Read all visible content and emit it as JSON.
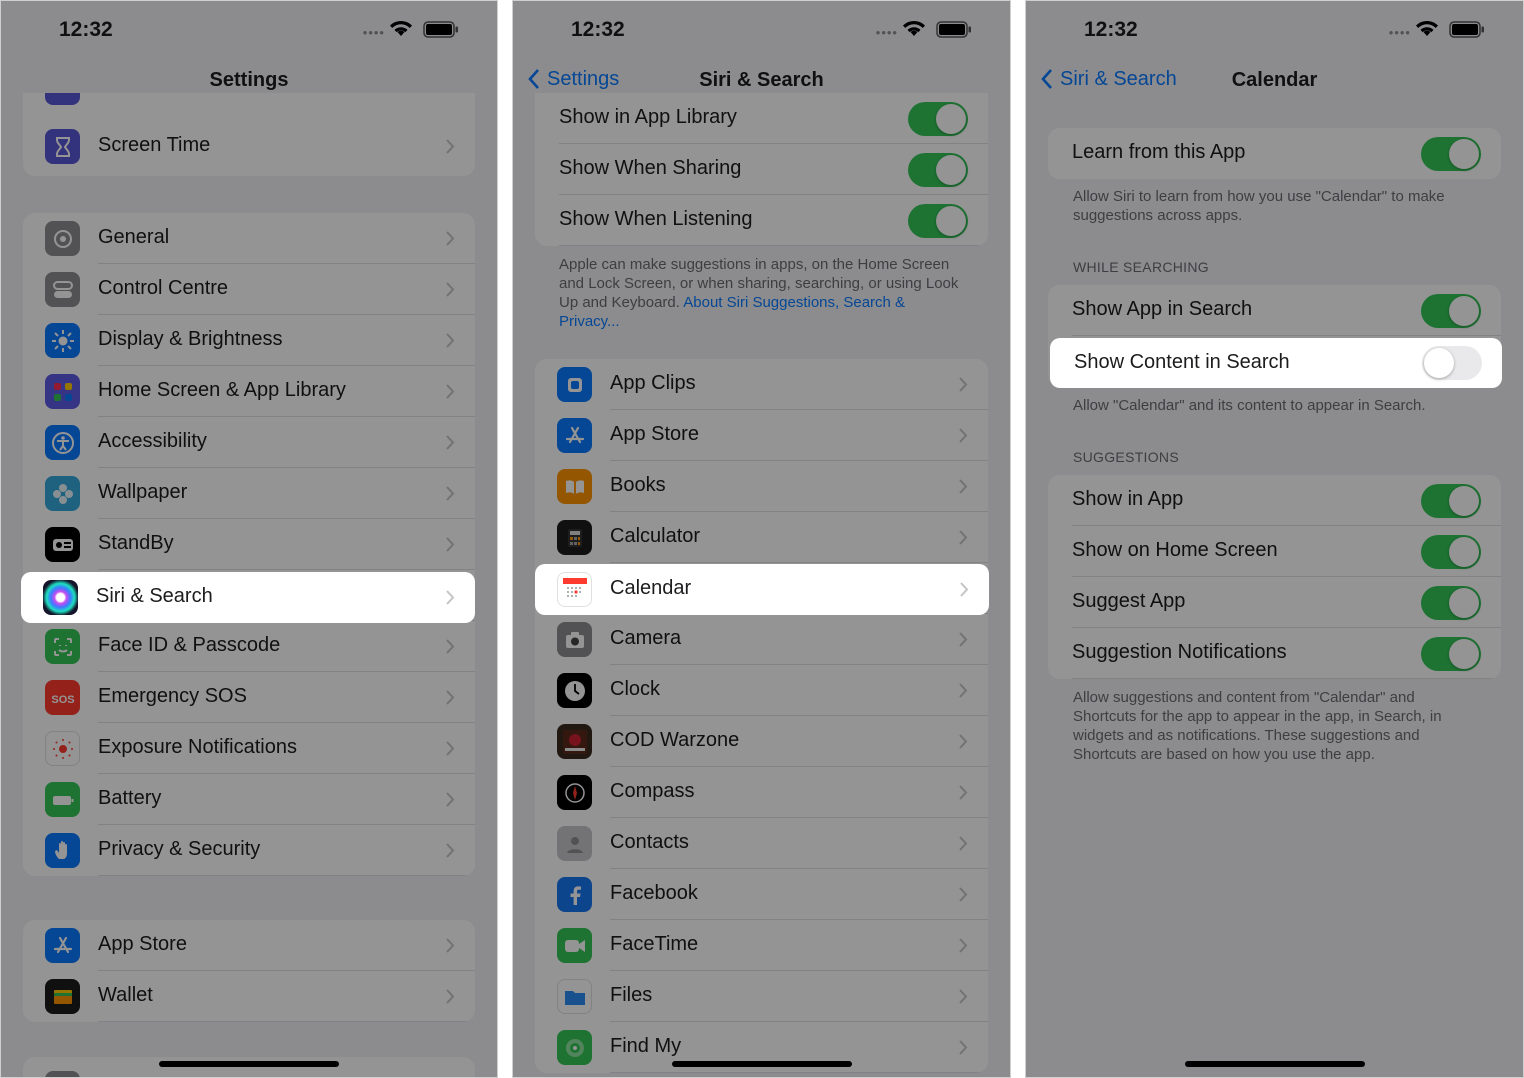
{
  "status": {
    "time": "12:32"
  },
  "screen1": {
    "title": "Settings",
    "group_top": [
      {
        "label": "Screen Time",
        "icon": "hourglass-icon",
        "color": "#5856d6"
      }
    ],
    "group_main": [
      {
        "label": "General",
        "icon": "gear-icon",
        "color": "#8e8e93"
      },
      {
        "label": "Control Centre",
        "icon": "switches-icon",
        "color": "#8e8e93"
      },
      {
        "label": "Display & Brightness",
        "icon": "sun-icon",
        "color": "#0a7aff"
      },
      {
        "label": "Home Screen & App Library",
        "icon": "app-grid-icon",
        "color": "#5e5ce6"
      },
      {
        "label": "Accessibility",
        "icon": "accessibility-icon",
        "color": "#0a7aff"
      },
      {
        "label": "Wallpaper",
        "icon": "flower-icon",
        "color": "#34aadc"
      },
      {
        "label": "StandBy",
        "icon": "standby-icon",
        "color": "#000000"
      },
      {
        "label": "Siri & Search",
        "icon": "siri-icon",
        "color": "#1c1c3a"
      },
      {
        "label": "Face ID & Passcode",
        "icon": "face-id-icon",
        "color": "#34c759"
      },
      {
        "label": "Emergency SOS",
        "icon": "sos-icon",
        "color": "#ff3b30"
      },
      {
        "label": "Exposure Notifications",
        "icon": "exposure-icon",
        "color": "#ffffff"
      },
      {
        "label": "Battery",
        "icon": "battery-icon",
        "color": "#34c759"
      },
      {
        "label": "Privacy & Security",
        "icon": "hand-icon",
        "color": "#0a7aff"
      }
    ],
    "group_bottom": [
      {
        "label": "App Store",
        "icon": "app-store-icon",
        "color": "#0a7aff"
      },
      {
        "label": "Wallet",
        "icon": "wallet-icon",
        "color": "#1c1c1e"
      }
    ],
    "sos_text": "SOS"
  },
  "screen2": {
    "back_label": "Settings",
    "title": "Siri & Search",
    "toggles": [
      {
        "label": "Show in App Library",
        "on": true
      },
      {
        "label": "Show When Sharing",
        "on": true
      },
      {
        "label": "Show When Listening",
        "on": true
      }
    ],
    "footer_text": "Apple can make suggestions in apps, on the Home Screen and Lock Screen, or when sharing, searching, or using Look Up and Keyboard.",
    "footer_link": "About Siri Suggestions, Search & Privacy...",
    "apps": [
      {
        "label": "App Clips",
        "icon": "app-clips-icon",
        "color": "#0a7aff"
      },
      {
        "label": "App Store",
        "icon": "app-store-icon",
        "color": "#0a7aff"
      },
      {
        "label": "Books",
        "icon": "books-icon",
        "color": "#ff9500"
      },
      {
        "label": "Calculator",
        "icon": "calculator-icon",
        "color": "#1c1c1e"
      },
      {
        "label": "Calendar",
        "icon": "calendar-icon",
        "color": "#ffffff"
      },
      {
        "label": "Camera",
        "icon": "camera-icon",
        "color": "#8e8e93"
      },
      {
        "label": "Clock",
        "icon": "clock-icon",
        "color": "#000000"
      },
      {
        "label": "COD Warzone",
        "icon": "cod-warzone-icon",
        "color": "#3a2a20"
      },
      {
        "label": "Compass",
        "icon": "compass-icon",
        "color": "#000000"
      },
      {
        "label": "Contacts",
        "icon": "contacts-icon",
        "color": "#c7c7cc"
      },
      {
        "label": "Facebook",
        "icon": "facebook-icon",
        "color": "#1877f2"
      },
      {
        "label": "FaceTime",
        "icon": "facetime-icon",
        "color": "#34c759"
      },
      {
        "label": "Files",
        "icon": "folder-icon",
        "color": "#ffffff"
      },
      {
        "label": "Find My",
        "icon": "find-my-icon",
        "color": "#34c759"
      }
    ]
  },
  "screen3": {
    "back_label": "Siri & Search",
    "title": "Calendar",
    "learn": {
      "label": "Learn from this App",
      "on": true
    },
    "learn_footer": "Allow Siri to learn from how you use \"Calendar\" to make suggestions across apps.",
    "while_searching_header": "WHILE SEARCHING",
    "searching": [
      {
        "label": "Show App in Search",
        "on": true
      },
      {
        "label": "Show Content in Search",
        "on": false
      }
    ],
    "searching_footer": "Allow \"Calendar\" and its content to appear in Search.",
    "suggestions_header": "SUGGESTIONS",
    "suggestions": [
      {
        "label": "Show in App",
        "on": true
      },
      {
        "label": "Show on Home Screen",
        "on": true
      },
      {
        "label": "Suggest App",
        "on": true
      },
      {
        "label": "Suggestion Notifications",
        "on": true
      }
    ],
    "suggestions_footer": "Allow suggestions and content from \"Calendar\" and Shortcuts for the app to appear in the app, in Search, in widgets and as notifications. These suggestions and Shortcuts are based on how you use the app."
  }
}
